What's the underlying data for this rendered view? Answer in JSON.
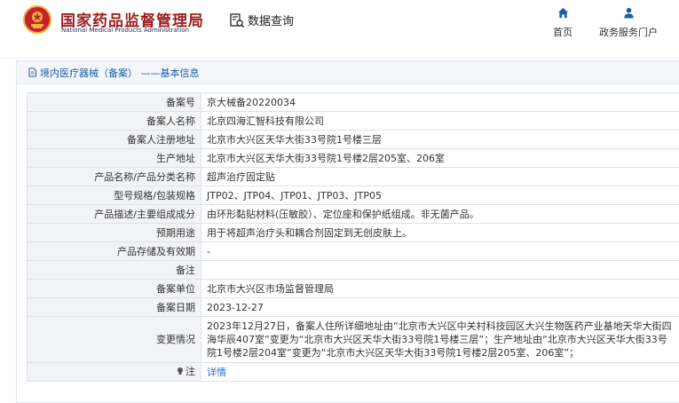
{
  "header": {
    "brand_cn": "国家药品监督管理局",
    "brand_en": "National Medical Products Administration",
    "query_label": "数据查询",
    "nav": [
      {
        "label": "首页",
        "icon": "home-icon"
      },
      {
        "label": "政务服务门户",
        "icon": "user-icon"
      }
    ],
    "colors": {
      "brand_red": "#9c1e1e",
      "nav_blue": "#1a5ea8"
    }
  },
  "breadcrumb": {
    "text": "境内医疗器械（备案） ——基本信息"
  },
  "record": {
    "rows": [
      {
        "key": "备案号",
        "value": "京大械备20220034"
      },
      {
        "key": "备案人名称",
        "value": "北京四海汇智科技有限公司"
      },
      {
        "key": "备案人注册地址",
        "value": "北京市大兴区天华大街33号院1号楼三层"
      },
      {
        "key": "生产地址",
        "value": "北京市大兴区天华大街33号院1号楼2层205室、206室"
      },
      {
        "key": "产品名称/产品分类名称",
        "value": "超声治疗固定贴"
      },
      {
        "key": "型号规格/包装规格",
        "value": "JTP02、JTP04、JTP01、JTP03、JTP05"
      },
      {
        "key": "产品描述/主要组成成分",
        "value": "由环形黏贴材料(压敏胶）、定位座和保护纸组成。非无菌产品。"
      },
      {
        "key": "预期用途",
        "value": "用于将超声治疗头和耦合剂固定到无创皮肤上。"
      },
      {
        "key": "产品存储及有效期",
        "value": "-"
      },
      {
        "key": "备注",
        "value": ""
      },
      {
        "key": "备案单位",
        "value": "北京市大兴区市场监督管理局"
      },
      {
        "key": "备案日期",
        "value": "2023-12-27"
      },
      {
        "key": "变更情况",
        "value": "2023年12月27日，备案人住所详细地址由“北京市大兴区中关村科技园区大兴生物医药产业基地天华大街四海华辰407室”变更为“北京市大兴区天华大街33号院1号楼三层”；生产地址由“北京市大兴区天华大街33号院1号楼2层204室”变更为“北京市大兴区天华大街33号院1号楼2层205室、206室”；"
      }
    ],
    "note_row": {
      "key": "注",
      "icon": "lightbulb-icon",
      "link": "详情"
    }
  }
}
